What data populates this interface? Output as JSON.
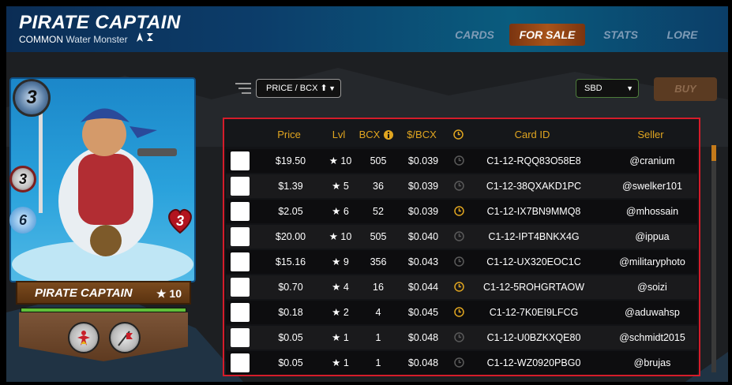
{
  "header": {
    "title": "PIRATE CAPTAIN",
    "rarity": "COMMON",
    "subtitle": "Water Monster",
    "tabs": [
      {
        "label": "CARDS",
        "active": false
      },
      {
        "label": "FOR SALE",
        "active": true
      },
      {
        "label": "STATS",
        "active": false
      },
      {
        "label": "LORE",
        "active": false
      }
    ]
  },
  "card": {
    "mana": "3",
    "attack": "3",
    "speed": "6",
    "health": "3",
    "name": "PIRATE CAPTAIN",
    "level": "★ 10",
    "xp_fraction": 1.0,
    "abilities": [
      "ability-1-icon",
      "ability-2-icon"
    ]
  },
  "controls": {
    "sort_value": "PRICE / BCX ⬆",
    "currency_value": "SBD",
    "buy_label": "BUY"
  },
  "table": {
    "headers": {
      "price": "Price",
      "lvl": "Lvl",
      "bcx": "BCX",
      "per_bcx": "$/BCX",
      "card_id": "Card ID",
      "seller": "Seller"
    },
    "rows": [
      {
        "price": "$19.50",
        "lvl": "★ 10",
        "bcx": "505",
        "per_bcx": "$0.039",
        "clock_active": false,
        "card_id": "C1-12-RQQ83O58E8",
        "seller": "@cranium"
      },
      {
        "price": "$1.39",
        "lvl": "★ 5",
        "bcx": "36",
        "per_bcx": "$0.039",
        "clock_active": false,
        "card_id": "C1-12-38QXAKD1PC",
        "seller": "@swelker101"
      },
      {
        "price": "$2.05",
        "lvl": "★ 6",
        "bcx": "52",
        "per_bcx": "$0.039",
        "clock_active": true,
        "card_id": "C1-12-IX7BN9MMQ8",
        "seller": "@mhossain"
      },
      {
        "price": "$20.00",
        "lvl": "★ 10",
        "bcx": "505",
        "per_bcx": "$0.040",
        "clock_active": false,
        "card_id": "C1-12-IPT4BNKX4G",
        "seller": "@ippua"
      },
      {
        "price": "$15.16",
        "lvl": "★ 9",
        "bcx": "356",
        "per_bcx": "$0.043",
        "clock_active": false,
        "card_id": "C1-12-UX320EOC1C",
        "seller": "@militaryphoto"
      },
      {
        "price": "$0.70",
        "lvl": "★ 4",
        "bcx": "16",
        "per_bcx": "$0.044",
        "clock_active": true,
        "card_id": "C1-12-5ROHGRTAOW",
        "seller": "@soizi"
      },
      {
        "price": "$0.18",
        "lvl": "★ 2",
        "bcx": "4",
        "per_bcx": "$0.045",
        "clock_active": true,
        "card_id": "C1-12-7K0EI9LFCG",
        "seller": "@aduwahsp"
      },
      {
        "price": "$0.05",
        "lvl": "★ 1",
        "bcx": "1",
        "per_bcx": "$0.048",
        "clock_active": false,
        "card_id": "C1-12-U0BZKXQE80",
        "seller": "@schmidt2015"
      },
      {
        "price": "$0.05",
        "lvl": "★ 1",
        "bcx": "1",
        "per_bcx": "$0.048",
        "clock_active": false,
        "card_id": "C1-12-WZ0920PBG0",
        "seller": "@brujas"
      }
    ]
  },
  "colors": {
    "accent_orange": "#e0a520",
    "clock_active": "#e0a520",
    "clock_inactive": "#5a5a5a",
    "highlight_border": "#d51c2a"
  }
}
